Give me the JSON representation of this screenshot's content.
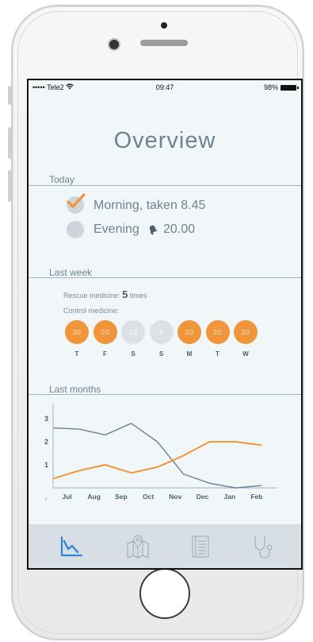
{
  "status_bar": {
    "carrier": "••••• Tele2",
    "time": "09:47",
    "battery": "98%"
  },
  "title": "Overview",
  "today": {
    "label": "Today",
    "items": [
      {
        "text": "Morning, taken 8.45",
        "checked": true
      },
      {
        "text": "Evening",
        "time": "20.00",
        "alarm": true,
        "checked": false
      }
    ]
  },
  "last_week": {
    "label": "Last week",
    "rescue_label": "Rescue medicine:",
    "rescue_count": "5",
    "rescue_unit": "times",
    "control_label": "Control medicine:",
    "days": [
      {
        "letter": "T",
        "value": "2/2",
        "complete": true
      },
      {
        "letter": "F",
        "value": "2/2",
        "complete": true
      },
      {
        "letter": "S",
        "value": "1/2",
        "complete": false
      },
      {
        "letter": "S",
        "value": "0",
        "complete": false
      },
      {
        "letter": "M",
        "value": "2/2",
        "complete": true
      },
      {
        "letter": "T",
        "value": "2/2",
        "complete": true
      },
      {
        "letter": "W",
        "value": "2/2",
        "complete": true
      }
    ]
  },
  "last_months": {
    "label": "Last months"
  },
  "chart_data": {
    "type": "line",
    "x": [
      "Jul",
      "Aug",
      "Sep",
      "Oct",
      "Nov",
      "Dec",
      "Jan",
      "Feb"
    ],
    "yticks": [
      "1",
      "2",
      "3"
    ],
    "ylim": [
      0,
      3.3
    ],
    "series": [
      {
        "values": [
          2.6,
          2.55,
          2.3,
          2.8,
          2.0,
          0.6,
          0.2,
          0.0,
          0.1
        ],
        "color": "#6d8393"
      },
      {
        "values": [
          0.4,
          0.75,
          1.0,
          0.65,
          0.9,
          1.4,
          2.0,
          2.0,
          1.85
        ],
        "color": "#f0953a"
      }
    ]
  },
  "colors": {
    "accent": "#f0953a",
    "muted": "#6d8393",
    "inactive": "#cdd5da",
    "tab_active": "#2f86d6"
  },
  "tabs": [
    {
      "name": "chart-icon",
      "active": true
    },
    {
      "name": "map-icon",
      "active": false
    },
    {
      "name": "notebook-icon",
      "active": false
    },
    {
      "name": "stethoscope-icon",
      "active": false
    }
  ]
}
